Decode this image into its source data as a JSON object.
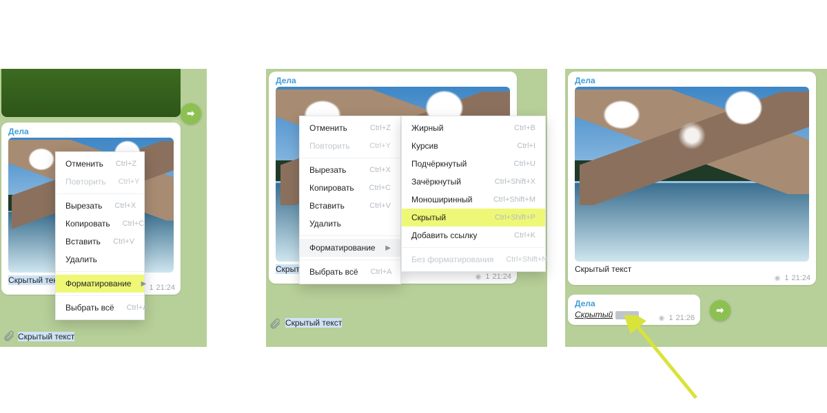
{
  "chat_title": "Дела",
  "captions": {
    "hidden_text": "Скрытый текст",
    "spoiler_word": "Скрытый"
  },
  "meta": {
    "views": "1",
    "time1": "21:24",
    "time2": "21:26"
  },
  "menu": {
    "undo": {
      "label": "Отменить",
      "shortcut": "Ctrl+Z"
    },
    "redo": {
      "label": "Повторить",
      "shortcut": "Ctrl+Y"
    },
    "cut": {
      "label": "Вырезать",
      "shortcut": "Ctrl+X"
    },
    "copy": {
      "label": "Копировать",
      "shortcut": "Ctrl+C"
    },
    "paste": {
      "label": "Вставить",
      "shortcut": "Ctrl+V"
    },
    "delete": {
      "label": "Удалить",
      "shortcut": ""
    },
    "formatting": {
      "label": "Форматирование",
      "shortcut": ""
    },
    "select_all": {
      "label": "Выбрать всё",
      "shortcut": "Ctrl+A"
    }
  },
  "submenu": {
    "bold": {
      "label": "Жирный",
      "shortcut": "Ctrl+B"
    },
    "italic": {
      "label": "Курсив",
      "shortcut": "Ctrl+I"
    },
    "underline": {
      "label": "Подчёркнутый",
      "shortcut": "Ctrl+U"
    },
    "strike": {
      "label": "Зачёркнутый",
      "shortcut": "Ctrl+Shift+X"
    },
    "mono": {
      "label": "Моноширинный",
      "shortcut": "Ctrl+Shift+M"
    },
    "spoiler": {
      "label": "Скрытый",
      "shortcut": "Ctrl+Shift+P"
    },
    "link": {
      "label": "Добавить ссылку",
      "shortcut": "Ctrl+K"
    },
    "clear": {
      "label": "Без форматирования",
      "shortcut": "Ctrl+Shift+N"
    }
  }
}
